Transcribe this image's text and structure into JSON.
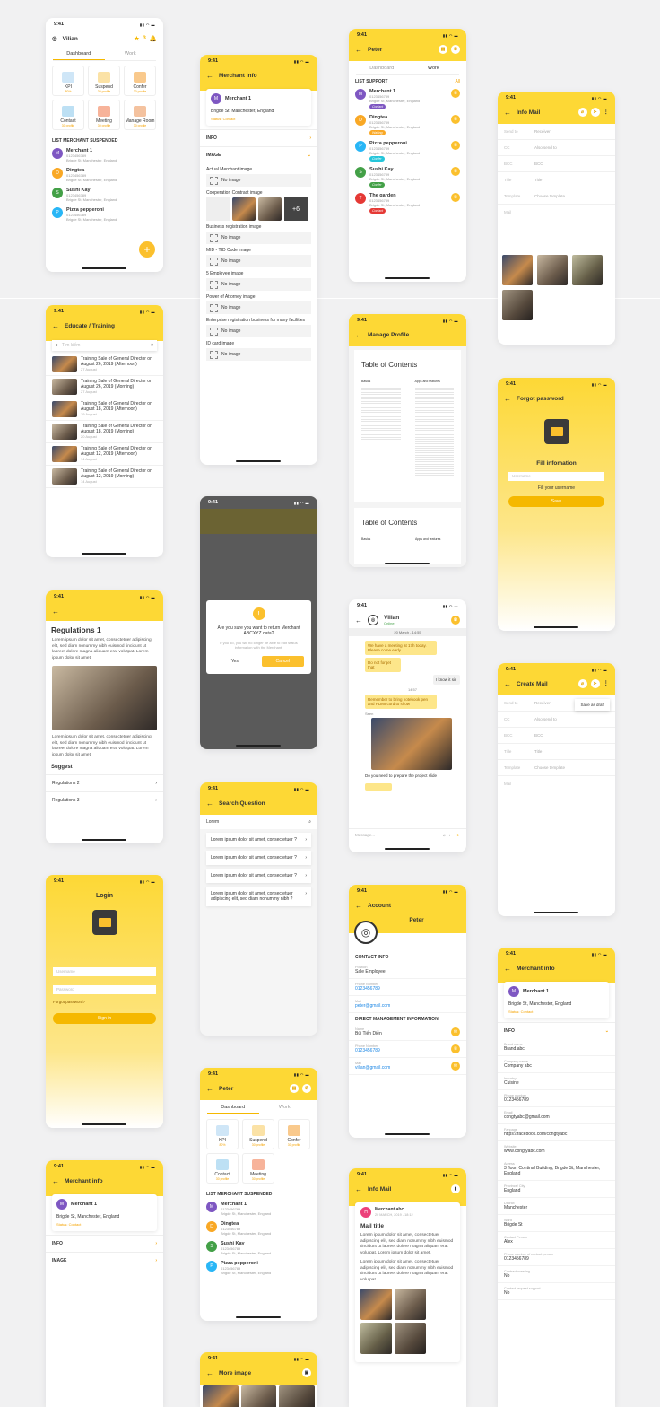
{
  "time": "9:41",
  "colors": {
    "accent": "#fdd835",
    "button": "#f5b800",
    "orange": "#f5a300"
  },
  "p1": {
    "user": "Vilian",
    "star_count": "3",
    "tabs": [
      "Dashboard",
      "Work"
    ],
    "tiles": [
      {
        "label": "KPI",
        "sub": "80%"
      },
      {
        "label": "Suspend",
        "sub": "30 profile"
      },
      {
        "label": "Confer",
        "sub": "30 profile"
      },
      {
        "label": "Contact",
        "sub": "30 profile"
      },
      {
        "label": "Meeting",
        "sub": "30 profile"
      },
      {
        "label": "Manage Room",
        "sub": "30 profile"
      }
    ],
    "list_title": "LIST MERCHANT SUSPENDED",
    "merchants": [
      {
        "initial": "M",
        "name": "Merchant 1",
        "phone": "0123456789",
        "addr": "Brigde St, Manchester, England"
      },
      {
        "initial": "D",
        "name": "Dingtea",
        "phone": "0123456789",
        "addr": "Brigde St, Manchester, England"
      },
      {
        "initial": "S",
        "name": "Sushi Kay",
        "phone": "0123456789",
        "addr": "Brigde St, Manchester, England"
      },
      {
        "initial": "P",
        "name": "Pizza pepperoni",
        "phone": "0123456789",
        "addr": "Brigde St, Manchester, England"
      }
    ],
    "fab": "+"
  },
  "p2": {
    "title": "Merchant info",
    "merchant": "Merchant 1",
    "addr": "Brigde St, Manchester, England",
    "status": "Status: Contact",
    "info": "INFO",
    "image": "IMAGE",
    "sections": [
      "Actual Merchant image",
      "Cooperation Contract image",
      "Business registration image",
      "MID - TID Code image",
      "5 Employee image",
      "Power of Attorney image",
      "Enterprise registration business for many facilities",
      "ID card image"
    ],
    "no_image": "No image",
    "plus_more": "+6"
  },
  "p3": {
    "title": "Peter",
    "tabs": [
      "Dashboard",
      "Work"
    ],
    "list_title": "LIST SUPPORT",
    "all": "All",
    "items": [
      {
        "initial": "M",
        "name": "Merchant 1",
        "tag": "Contact"
      },
      {
        "initial": "D",
        "name": "Dingtea",
        "tag": "Waiting"
      },
      {
        "initial": "P",
        "name": "Pizza pepperoni",
        "tag": "Confer"
      },
      {
        "initial": "S",
        "name": "Sushi Kay",
        "tag": "Confer"
      },
      {
        "initial": "T",
        "name": "The garden",
        "tag": "Contact"
      }
    ],
    "phone": "0123456789",
    "addr": "Brigde St, Manchester, England"
  },
  "p4": {
    "title": "Info Mail",
    "fields": [
      {
        "k": "Send to",
        "v": "Receiver"
      },
      {
        "k": "CC",
        "v": "Also send to"
      },
      {
        "k": "BCC",
        "v": "BCC"
      },
      {
        "k": "Title",
        "v": "Title"
      },
      {
        "k": "Template",
        "v": "Choose template"
      },
      {
        "k": "Mail",
        "v": ""
      }
    ]
  },
  "p5": {
    "title": "Educate / Training",
    "search": "Tìm kiếm",
    "items": [
      {
        "t": "Training Sale of General Director on August 26, 2019 (Afternoon)",
        "d": "27 August"
      },
      {
        "t": "Training Sale of General Director on August 26, 2019 (Morning)",
        "d": "27 August"
      },
      {
        "t": "Training Sale of General Director on August 18, 2019 (Afternoon)",
        "d": "19 August"
      },
      {
        "t": "Training Sale of General Director on August 18, 2019 (Morning)",
        "d": "20 August"
      },
      {
        "t": "Training Sale of General Director on August 12, 2019 (Afternoon)",
        "d": "14 August"
      },
      {
        "t": "Training Sale of General Director on August 12, 2019 (Morning)",
        "d": "14 August"
      }
    ]
  },
  "p6": {
    "title": "Manage Profile",
    "toc": "Table of Contents",
    "basics": "Basics",
    "apps": "Apps and features"
  },
  "p7": {
    "title": "Forgot password",
    "fill": "Fill infomation",
    "placeholder": "Username",
    "hint": "Fill your username",
    "btn": "Save"
  },
  "p8": {
    "title": "Regulations 1",
    "para": "Lorem ipsum dolor sit amet, consectetuer adipiscing elit, sed diam nonummy nibh euismod tincidunt ut laoreet dolore magna aliquam erat volutpat. Lorem ipsum dolor sit amet.",
    "para2": "Lorem ipsum dolor sit amet, consectetuer adipiscing elit, sed diam nonummy nibh euismod tincidunt ut laoreet dolore magna aliquam erat volutpat. Lorem ipsum dolor sit amet.",
    "suggest": "Suggest",
    "links": [
      "Regulations 2",
      "Regulations 3"
    ]
  },
  "p9": {
    "question": "Are you sure you want to return Merchant ABCXYZ data?",
    "note": "If you do, you will no longer be able to edit status information with the Merchant.",
    "yes": "Yes",
    "cancel": "Cancel"
  },
  "p10": {
    "name": "Vilian",
    "status": "Online",
    "date": "20 March - 14:55",
    "m1": "We have a meeting at 17h today. Please come early",
    "m2": "Do not forget that",
    "r1": "I know it sir",
    "time2": "14:57",
    "m3": "Remember to bring notebook pen and HDMI cord to show",
    "m4": "Seen",
    "file": "Do you need to prepare the project slide",
    "input": "Message..."
  },
  "p11": {
    "title": "Create Mail",
    "draft": "Save as draft",
    "fields": [
      {
        "k": "Send to",
        "v": "Receiver"
      },
      {
        "k": "CC",
        "v": "Also send to"
      },
      {
        "k": "BCC",
        "v": "BCC"
      },
      {
        "k": "Title",
        "v": "Title"
      },
      {
        "k": "Template",
        "v": "Choose template"
      },
      {
        "k": "Mail",
        "v": ""
      }
    ]
  },
  "p12": {
    "title": "Login",
    "user": "Username",
    "pass": "Password",
    "forgot": "Forgot password?",
    "btn": "Sign in"
  },
  "p13": {
    "title": "Search Question",
    "query": "Lorem",
    "items": [
      "Lorem ipsum dolor sit amet, consectetuer ?",
      "Lorem ipsum dolor sit amet, consectetuer ?",
      "Lorem ipsum dolor sit amet, consectetuer ?",
      "Lorem ipsum dolor sit amet, consectetuer adipiscing elit, sed diam nonummy nibh ?"
    ]
  },
  "p14": {
    "title": "Account",
    "name": "Peter",
    "contact": "CONTACT INFO",
    "position_k": "Position",
    "position_v": "Sale Employee",
    "phone_k": "Phone Number",
    "phone_v": "0123456789",
    "mail_k": "Mail",
    "mail_v": "peter@gmail.com",
    "direct": "DIRECT MANAGEMENT INFORMATION",
    "name_k": "Name",
    "name_v": "Bùi Tiến Diễn",
    "phone2_v": "0123456789",
    "mail2_v": "vilian@gmail.com"
  },
  "p15": {
    "title": "Merchant info",
    "merchant": "Merchant 1",
    "addr": "Brigde St, Manchester, England",
    "status": "Status: Contact",
    "info": "INFO",
    "fields": [
      {
        "k": "Brand name",
        "v": "Brand.abc"
      },
      {
        "k": "Company name",
        "v": "Company abc"
      },
      {
        "k": "Industry",
        "v": "Cuisine"
      },
      {
        "k": "Phone number",
        "v": "0123456789"
      },
      {
        "k": "Email",
        "v": "congtyabc@gmail.com"
      },
      {
        "k": "Fanpage",
        "v": "https://facebook.com/congtyabc"
      },
      {
        "k": "Website",
        "v": "www.congtyabc.com"
      },
      {
        "k": "Adress",
        "v": "3 floor, Continal Building, Brigde St, Manchester, England"
      },
      {
        "k": "Province/ City",
        "v": "England"
      },
      {
        "k": "District",
        "v": "Manchester"
      },
      {
        "k": "Ward",
        "v": "Brigde St"
      },
      {
        "k": "Contact Person",
        "v": "Alex"
      },
      {
        "k": "Phone number of contact person",
        "v": "0123456789"
      },
      {
        "k": "Contract meeting",
        "v": "No"
      },
      {
        "k": "Contact request support",
        "v": "No"
      }
    ]
  },
  "p16": {
    "title": "Merchant info",
    "merchant": "Merchant 1",
    "addr": "Brigde St, Manchester, England",
    "status": "Status: Contact",
    "info": "INFO",
    "image": "IMAGE"
  },
  "p17": {
    "title": "Peter",
    "tabs": [
      "Dashboard",
      "Work"
    ],
    "tiles": [
      {
        "label": "KPI",
        "sub": "80%"
      },
      {
        "label": "Suspend",
        "sub": "30 profile"
      },
      {
        "label": "Confer",
        "sub": "30 profile"
      },
      {
        "label": "Contact",
        "sub": "30 profile"
      },
      {
        "label": "Meeting",
        "sub": "30 profile"
      }
    ],
    "list_title": "LIST MERCHANT SUSPENDED",
    "merchants": [
      {
        "initial": "M",
        "name": "Merchant 1"
      },
      {
        "initial": "D",
        "name": "Dingtea"
      },
      {
        "initial": "S",
        "name": "Sushi Kay"
      },
      {
        "initial": "P",
        "name": "Pizza pepperoni"
      }
    ],
    "phone": "0123456789",
    "addr": "Brigde St, Manchester, England"
  },
  "p18": {
    "title": "Info Mail",
    "sender": "Merchant abc",
    "date": "20 MARCH, 2019 - 18:12",
    "mail_title": "Mail title",
    "para": "Lorem ipsum dolor sit amet, consectetuer adipiscing elit, sed diam nonummy nibh euismod tincidunt ut laoreet dolore magna aliquam erat volutpat. Lorem ipsum dolor sit amet.",
    "para2": "Lorem ipsum dolor sit amet, consectetuer adipiscing elit, sed diam nonummy nibh euismod tincidunt ut laoreet dolore magna aliquam erat volutpat."
  },
  "p19": {
    "title": "More image"
  }
}
